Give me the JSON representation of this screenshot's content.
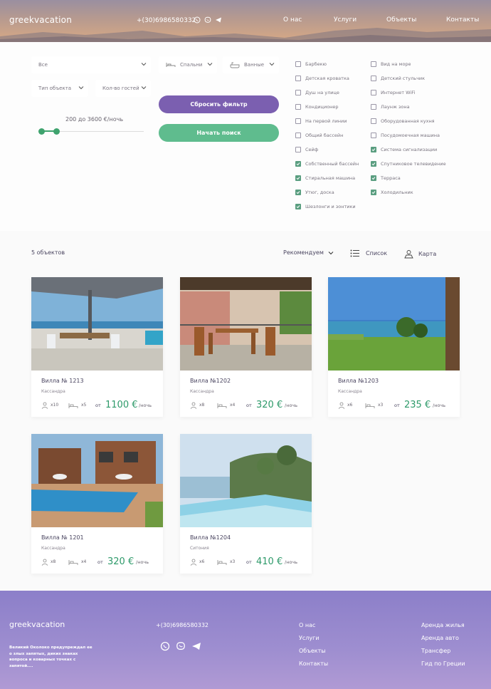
{
  "header": {
    "logo": "greekvacation",
    "phone": "+(30)6986580332",
    "social_icons": [
      "whatsapp-icon",
      "viber-icon",
      "telegram-icon"
    ],
    "nav": [
      "О нас",
      "Услуги",
      "Объекты",
      "Контакты"
    ]
  },
  "filters": {
    "region": "Все",
    "bedrooms": "Спальни",
    "bathrooms": "Ванные",
    "property_type": "Тип объекта",
    "guests": "Кол-во гостей",
    "price_label": "200 до 3600 €/ночь",
    "price_range": [
      200,
      3600
    ],
    "reset_label": "Сбросить фильтр",
    "search_label": "Начать поиск",
    "amenities_left": [
      {
        "label": "Барбекю",
        "checked": false
      },
      {
        "label": "Детская кроватка",
        "checked": false
      },
      {
        "label": "Душ на улице",
        "checked": false
      },
      {
        "label": "Кондиционер",
        "checked": false
      },
      {
        "label": "На первой линии",
        "checked": false
      },
      {
        "label": "Общий бассейн",
        "checked": false
      },
      {
        "label": "Сейф",
        "checked": false
      },
      {
        "label": "Собственный бассейн",
        "checked": true
      },
      {
        "label": "Стиральная машина",
        "checked": true
      },
      {
        "label": "Утюг, доска",
        "checked": true
      },
      {
        "label": "Шезлонги и зонтики",
        "checked": true
      }
    ],
    "amenities_right": [
      {
        "label": "Вид на море",
        "checked": false
      },
      {
        "label": "Детский стульчик",
        "checked": false
      },
      {
        "label": "Интернет WiFi",
        "checked": false
      },
      {
        "label": "Лаунж зона",
        "checked": false
      },
      {
        "label": "Оборудованная кухня",
        "checked": false
      },
      {
        "label": "Посудомоечная машина",
        "checked": false
      },
      {
        "label": "Система сигнализации",
        "checked": true
      },
      {
        "label": "Спутниковое телевидение",
        "checked": true
      },
      {
        "label": "Терраса",
        "checked": true
      },
      {
        "label": "Холодильник",
        "checked": true
      }
    ]
  },
  "results": {
    "count": "5 объектов",
    "sort": "Рекомендуем",
    "list_label": "Список",
    "map_label": "Карта"
  },
  "cards": [
    {
      "title": "Вилла № 1213",
      "location": "Кассандра",
      "guests": "x10",
      "beds": "x5",
      "from": "от",
      "price": "1100 €",
      "per": "/ночь"
    },
    {
      "title": "Вилла №1202",
      "location": "Кассандра",
      "guests": "x8",
      "beds": "x4",
      "from": "от",
      "price": "320 €",
      "per": "/ночь"
    },
    {
      "title": "Вилла №1203",
      "location": "Кассандра",
      "guests": "x6",
      "beds": "x3",
      "from": "от",
      "price": "235 €",
      "per": "/ночь"
    },
    {
      "title": "Вилла № 1201",
      "location": "Кассандра",
      "guests": "x8",
      "beds": "x4",
      "from": "от",
      "price": "320 €",
      "per": "/ночь"
    },
    {
      "title": "Вилла №1204",
      "location": "Ситония",
      "guests": "x6",
      "beds": "x3",
      "from": "от",
      "price": "410 €",
      "per": "/ночь"
    }
  ],
  "footer": {
    "logo": "greekvacation",
    "description": "Великий Околоко предупреждал ее о злых запятых, диких знаках вопроса и коварных точках с запятой....",
    "phone": "+(30)6986580332",
    "links_col1": [
      "О нас",
      "Услуги",
      "Объекты",
      "Контакты"
    ],
    "links_col2": [
      "Аренда жилья",
      "Аренда авто",
      "Трансфер",
      "Гид по Греции"
    ]
  }
}
